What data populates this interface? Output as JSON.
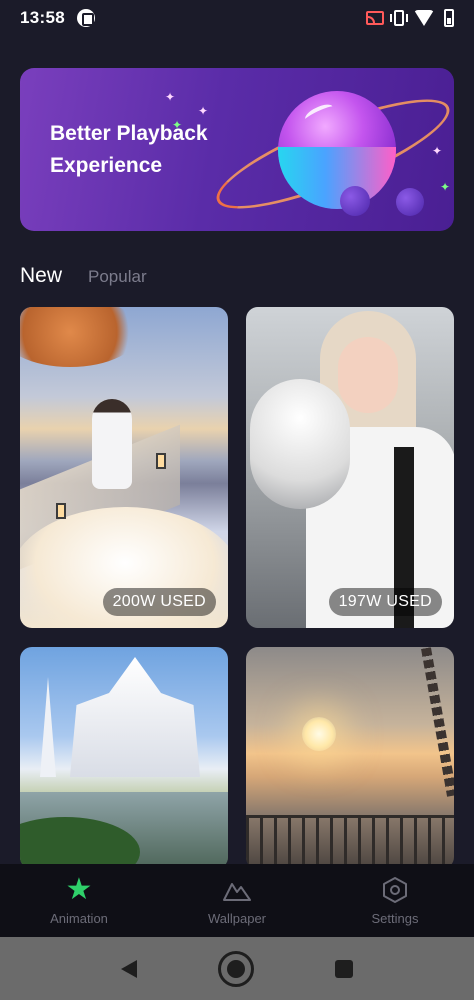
{
  "status_bar": {
    "time": "13:58",
    "icons": [
      "notification-icon",
      "cast-icon",
      "vibrate-icon",
      "wifi-icon",
      "battery-icon"
    ]
  },
  "banner": {
    "title_line1": "Better Playback",
    "title_line2": "Experience"
  },
  "tabs": [
    {
      "label": "New",
      "active": true
    },
    {
      "label": "Popular",
      "active": false
    }
  ],
  "cards": [
    {
      "subject": "girl-on-cloud-walkway",
      "usage": "200W USED"
    },
    {
      "subject": "girl-holding-cat",
      "usage": "197W USED"
    },
    {
      "subject": "white-temple",
      "usage": ""
    },
    {
      "subject": "sunset-balcony",
      "usage": ""
    }
  ],
  "bottom_nav": [
    {
      "label": "Animation",
      "icon": "star-icon",
      "active": true
    },
    {
      "label": "Wallpaper",
      "icon": "mountain-icon",
      "active": false
    },
    {
      "label": "Settings",
      "icon": "hexagon-icon",
      "active": false
    }
  ],
  "colors": {
    "background": "#1b1b29",
    "accent": "#2fd06a",
    "banner_start": "#7a3fbd",
    "banner_end": "#4a1f93",
    "inactive_text": "#6c6c78"
  }
}
